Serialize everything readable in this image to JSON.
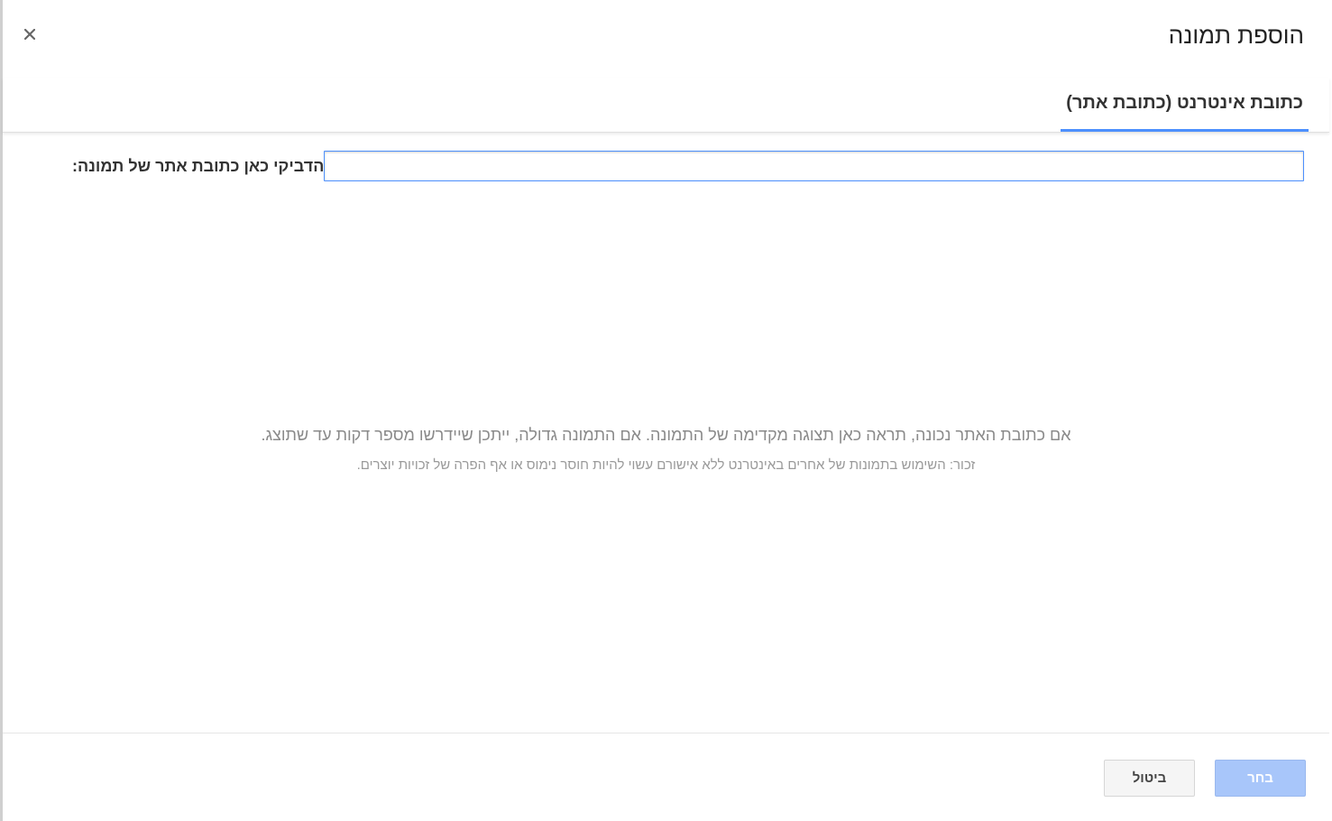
{
  "dialog": {
    "title": "הוספת תמונה",
    "close_icon": "close-icon"
  },
  "tabs": [
    {
      "label": "כתובת אינטרנט (כתובת אתר)",
      "active": true
    }
  ],
  "url_field": {
    "label": "הדביקי כאן כתובת אתר של תמונה:",
    "value": "",
    "placeholder": ""
  },
  "preview": {
    "message": "אם כתובת האתר נכונה, תראה כאן תצוגה מקדימה של התמונה. אם התמונה גדולה, ייתכן שיידרשו מספר דקות עד שתוצג.",
    "note": "זכור: השימוש בתמונות של אחרים באינטרנט ללא אישורם עשוי להיות חוסר נימוס או אף הפרה של זכויות יוצרים."
  },
  "footer": {
    "select_label": "בחר",
    "cancel_label": "ביטול"
  },
  "colors": {
    "accent": "#4d90fe",
    "select_button_disabled": "#a8c6fa"
  }
}
